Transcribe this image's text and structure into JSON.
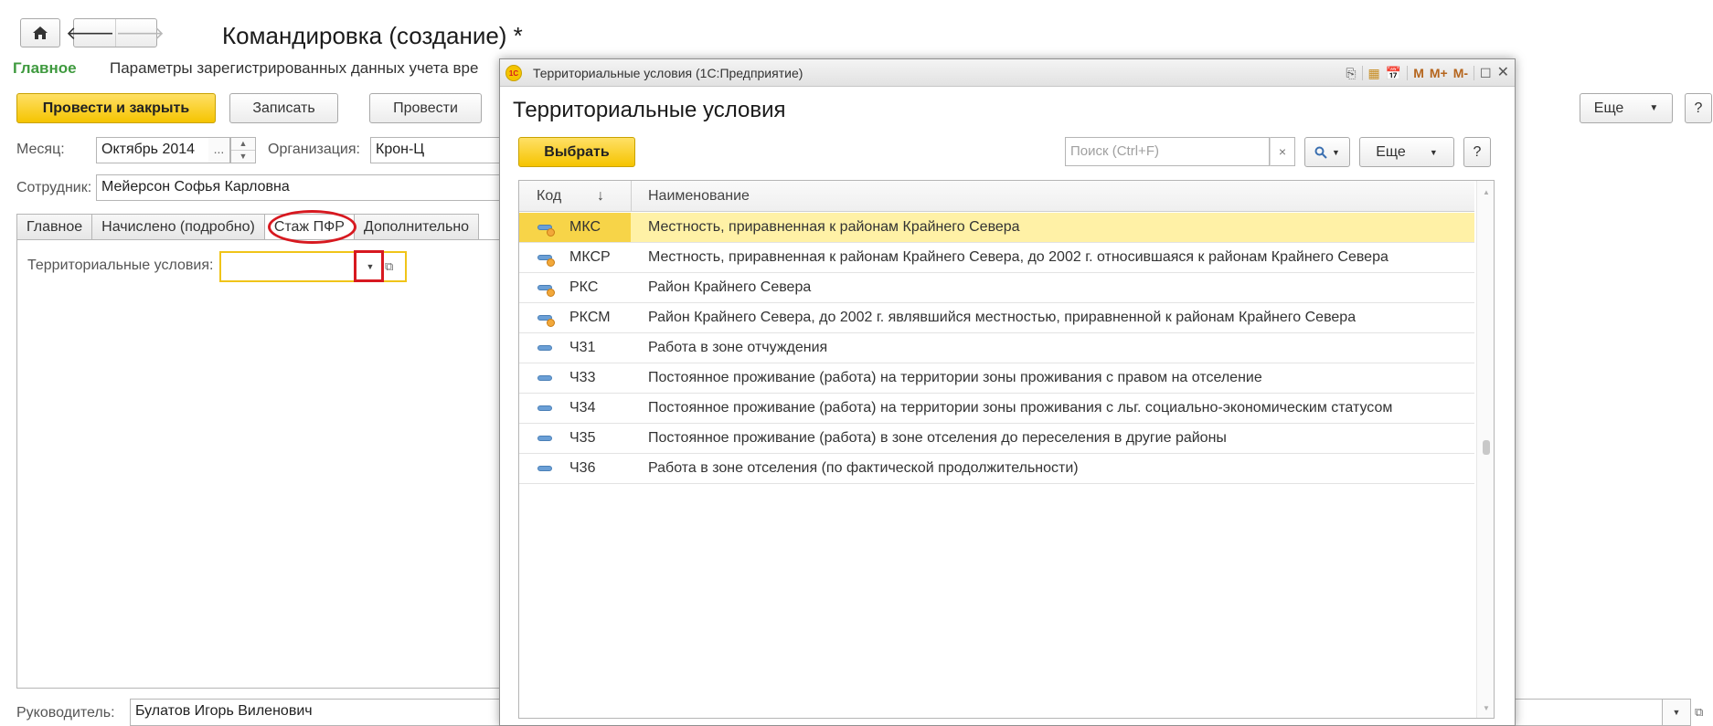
{
  "form": {
    "title": "Командировка (создание) *",
    "nav": {
      "home_icon": "home-icon",
      "back_icon": "arrow-left-icon",
      "forward_icon": "arrow-right-icon"
    },
    "links": {
      "main": "Главное",
      "params": "Параметры зарегистрированных данных учета вре"
    },
    "toolbar": {
      "post_close": "Провести и закрыть",
      "write": "Записать",
      "post": "Провести",
      "more": "Еще",
      "help": "?"
    },
    "month": {
      "label": "Месяц:",
      "value": "Октябрь 2014",
      "dots": "..."
    },
    "organization": {
      "label": "Организация:",
      "value": "Крон-Ц"
    },
    "employee": {
      "label": "Сотрудник:",
      "value": "Мейерсон Софья Карловна"
    },
    "tabs": [
      {
        "label": "Главное"
      },
      {
        "label": "Начислено (подробно)"
      },
      {
        "label": "Стаж ПФР"
      },
      {
        "label": "Дополнительно"
      }
    ],
    "territorial": {
      "label": "Территориальные условия:",
      "value": ""
    },
    "head": {
      "label": "Руководитель:",
      "value": "Булатов Игорь Виленович"
    }
  },
  "dialog": {
    "window_title": "Территориальные условия  (1С:Предприятие)",
    "logo_text": "1С",
    "heading": "Территориальные условия",
    "choose_label": "Выбрать",
    "search": {
      "placeholder": "Поиск (Ctrl+F)",
      "clear": "×"
    },
    "more_label": "Еще",
    "help_label": "?",
    "titlebar_icons": {
      "m": "M",
      "mplus": "M+",
      "mminus": "M-"
    },
    "columns": {
      "code": "Код",
      "sort_arrow": "↓",
      "name": "Наименование"
    },
    "rows": [
      {
        "code": "МКС",
        "name": "Местность, приравненная к районам Крайнего Севера",
        "selected": true,
        "icon": "warm"
      },
      {
        "code": "МКСР",
        "name": "Местность, приравненная к районам Крайнего Севера, до 2002 г. относившаяся к районам Крайнего Севера",
        "icon": "warm"
      },
      {
        "code": "РКС",
        "name": "Район Крайнего Севера",
        "icon": "warm"
      },
      {
        "code": "РКСМ",
        "name": "Район Крайнего Севера, до 2002 г. являвшийся местностью, приравненной к районам Крайнего Севера",
        "icon": "warm"
      },
      {
        "code": "Ч31",
        "name": "Работа в зоне отчуждения",
        "icon": "plain"
      },
      {
        "code": "Ч33",
        "name": "Постоянное проживание (работа) на территории зоны проживания с правом на отселение",
        "icon": "plain"
      },
      {
        "code": "Ч34",
        "name": "Постоянное проживание (работа) на территории зоны проживания с льг. социально-экономическим статусом",
        "icon": "plain"
      },
      {
        "code": "Ч35",
        "name": "Постоянное проживание (работа) в зоне отселения до переселения в другие районы",
        "icon": "plain"
      },
      {
        "code": "Ч36",
        "name": "Работа в зоне отселения (по фактической продолжительности)",
        "icon": "plain"
      }
    ]
  },
  "colors": {
    "accent_yellow": "#f5c400",
    "selected_row": "#fff1a6",
    "selected_code": "#f7d448",
    "highlight_red": "#d71920",
    "link_green": "#3f9a3f"
  }
}
